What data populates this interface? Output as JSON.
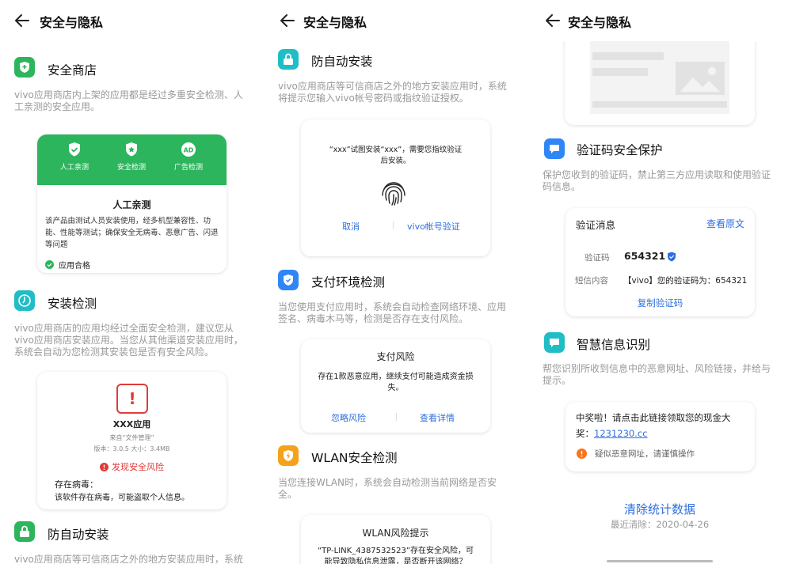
{
  "header": {
    "title": "安全与隐私"
  },
  "colors": {
    "green": "#2db55d",
    "teal": "#1fbec6",
    "blue": "#2f86f6",
    "orange": "#f5a21b",
    "red": "#e03b3b",
    "link": "#2f6fe0"
  },
  "panel1": {
    "store": {
      "title": "安全商店",
      "desc_lines": [
        "vivo应用商店内上架的应用都是经过多重安全检测、人",
        "工亲测的安全应用。"
      ],
      "badges": [
        "人工亲测",
        "安全检测",
        "广告检测"
      ],
      "card_title": "人工亲测",
      "card_text_lines": [
        "该产品由测试人员安装使用，经多机型兼容性、功",
        "能、性能等测试；确保安全无病毒、恶意广告、闪退",
        "等问题"
      ],
      "pass_label": "应用合格"
    },
    "install_check": {
      "title": "安装检测",
      "desc_lines": [
        "vivo应用商店的应用均经过全面安全检测，建议您从",
        "vivo应用商店安装应用。当您从其他渠道安装应用时，",
        "系统会自动为您检测其安装包是否有安全风险。"
      ],
      "app_name": "XXX应用",
      "source": "来自“文件管理”",
      "version": "版本：3.0.5  大小：3.4MB",
      "risk": "发现安全风险",
      "virus_title": "存在病毒：",
      "virus_desc": "该软件存在病毒，可能盗取个人信息。"
    },
    "anti_install": {
      "title": "防自动安装",
      "desc_partial": "vivo应用商店等可信商店之外的地方安装应用时，系统"
    }
  },
  "panel2": {
    "anti_install": {
      "title": "防自动安装",
      "desc_lines": [
        "vivo应用商店等可信商店之外的地方安装应用时，系统",
        "将提示您输入vivo帐号密码或指纹验证授权。"
      ],
      "dialog_lines": [
        "“xxx”试图安装“xxx”，需要您指纹验证",
        "后安装。"
      ],
      "cancel": "取消",
      "verify": "vivo帐号验证"
    },
    "payment": {
      "title": "支付环境检测",
      "desc_lines": [
        "当您使用支付应用时，系统会自动检查网络环境、应用",
        "签名、病毒木马等，检测是否存在支付风险。"
      ],
      "card_title": "支付风险",
      "card_text_lines": [
        "存在1款恶意应用，继续支付可能造成资金损",
        "失。"
      ],
      "ignore": "忽略风险",
      "detail": "查看详情"
    },
    "wlan": {
      "title": "WLAN安全检测",
      "desc_lines": [
        "当您连接WLAN时，系统会自动检测当前网络是否安",
        "全。"
      ],
      "card_title": "WLAN风险提示",
      "card_text_lines": [
        "“TP-LINK_4387532523”存在安全风险，可",
        "能导致隐私信息泄露，是否断开该网络？"
      ]
    }
  },
  "panel3": {
    "sms_protect": {
      "title": "验证码安全保护",
      "desc_lines": [
        "保护您收到的验证码，禁止第三方应用读取和使用验证",
        "码信息。"
      ],
      "card_title": "验证消息",
      "view_original": "查看原文",
      "code_label": "验证码",
      "code_value": "654321",
      "content_label": "短信内容",
      "content_value": "【vivo】您的验证码为：654321",
      "copy": "复制验证码"
    },
    "smart_info": {
      "title": "智慧信息识别",
      "desc_lines": [
        "帮您识别所收到信息中的恶意网址、风险链接，并给与",
        "提示。"
      ],
      "msg_line1": "中奖啦！请点击此链接领取您的现金大",
      "msg_prefix": "奖：",
      "msg_link": "1231230.cc",
      "warn": "疑似恶意网址，请谨慎操作"
    },
    "stats": {
      "clear": "清除统计数据",
      "last_clear": "最近清除：2020-04-26"
    }
  }
}
